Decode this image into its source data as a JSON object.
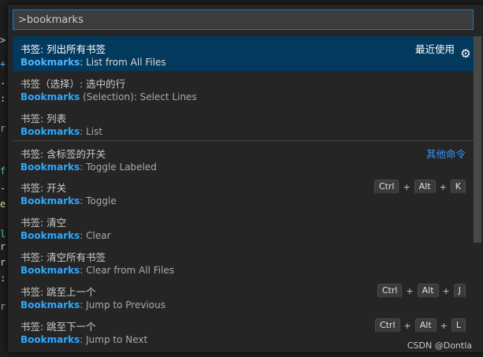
{
  "input": {
    "value": ">bookmarks"
  },
  "items": [
    {
      "title": "书签: 列出所有书签",
      "highlight": "Bookmarks",
      "detail": ": List from All Files",
      "right_label": "最近使用",
      "has_gear": true,
      "selected": true
    },
    {
      "title": "书签（选择）: 选中的行",
      "highlight": "Bookmarks",
      "detail": " (Selection): Select Lines"
    },
    {
      "title": "书签: 列表",
      "highlight": "Bookmarks",
      "detail": ": List"
    },
    {
      "title": "书签: 含标签的开关",
      "highlight": "Bookmarks",
      "detail": ": Toggle Labeled",
      "right_link": "其他命令",
      "separator": true
    },
    {
      "title": "书签: 开关",
      "highlight": "Bookmarks",
      "detail": ": Toggle",
      "keys": [
        "Ctrl",
        "Alt",
        "K"
      ]
    },
    {
      "title": "书签: 清空",
      "highlight": "Bookmarks",
      "detail": ": Clear"
    },
    {
      "title": "书签: 清空所有书签",
      "highlight": "Bookmarks",
      "detail": ": Clear from All Files"
    },
    {
      "title": "书签: 跳至上一个",
      "highlight": "Bookmarks",
      "detail": ": Jump to Previous",
      "keys": [
        "Ctrl",
        "Alt",
        "J"
      ]
    },
    {
      "title": "书签: 跳至下一个",
      "highlight": "Bookmarks",
      "detail": ": Jump to Next",
      "keys": [
        "Ctrl",
        "Alt",
        "L"
      ]
    }
  ],
  "key_separator": "+",
  "watermark": "CSDN @Dontla",
  "colors": {
    "accent": "#007fd4",
    "highlight": "#2aaaff",
    "selected_bg": "#04395e",
    "link": "#3794ff"
  }
}
